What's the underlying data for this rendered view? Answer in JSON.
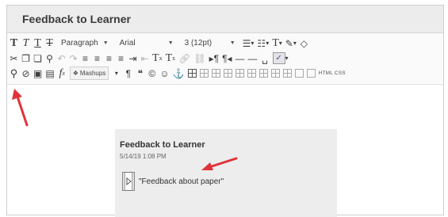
{
  "editor": {
    "title": "Feedback to Learner",
    "format_dropdown": "Paragraph",
    "font_dropdown": "Arial",
    "size_dropdown": "3 (12pt)",
    "mashups_label": "Mashups",
    "html_css_label": "HTML CSS"
  },
  "preview": {
    "title": "Feedback to Learner",
    "timestamp": "5/14/19 1:08 PM",
    "attachment_text": "\"Feedback about paper\""
  },
  "colors": {
    "annotation_arrow": "#e0333a",
    "header_bg": "#ececec",
    "preview_bg": "#ededed"
  }
}
